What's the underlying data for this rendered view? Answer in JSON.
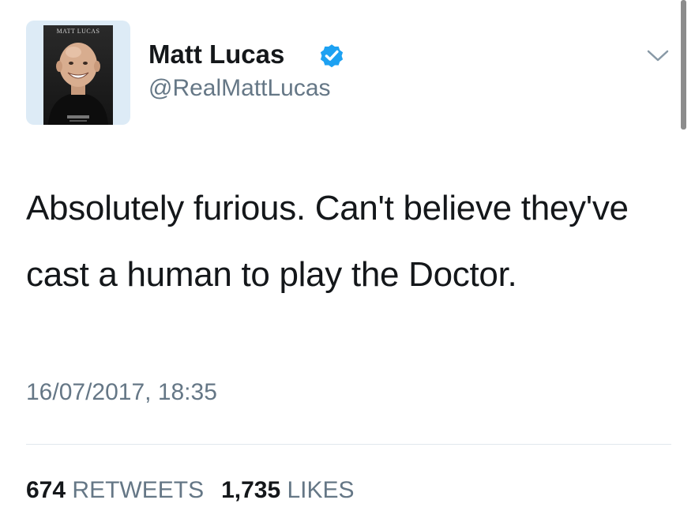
{
  "tweet": {
    "author": {
      "name": "Matt Lucas",
      "handle": "@RealMattLucas",
      "avatar_caption": "MATT LUCAS",
      "verified": true
    },
    "text": "Absolutely furious. Can't believe they've cast a human to play the Doctor.",
    "timestamp": "16/07/2017, 18:35",
    "stats": {
      "retweets_count": "674",
      "retweets_label": "RETWEETS",
      "likes_count": "1,735",
      "likes_label": "LIKES"
    }
  },
  "colors": {
    "verified_badge": "#1da1f2",
    "secondary_text": "#657786",
    "primary_text": "#14171a",
    "divider": "#e1e8ed"
  },
  "icons": {
    "verified": "verified-badge-icon",
    "menu": "chevron-down-icon"
  }
}
